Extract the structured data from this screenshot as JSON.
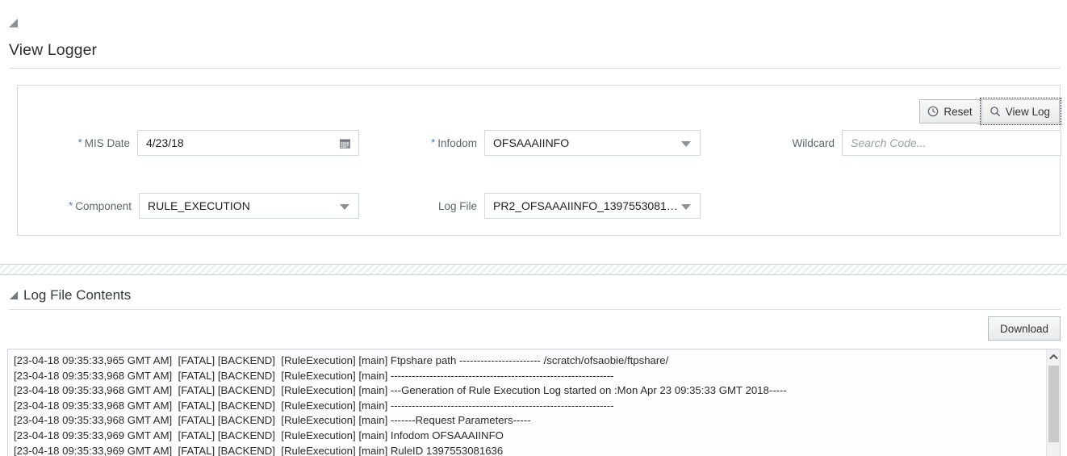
{
  "page": {
    "title": "View Logger",
    "collapse_icon": "triangle-collapse-icon"
  },
  "toolbar": {
    "reset_label": "Reset",
    "reset_icon": "clock-icon",
    "view_log_label": "View Log",
    "view_log_icon": "search-icon"
  },
  "form": {
    "mis_date": {
      "label": "MIS Date",
      "required": true,
      "value": "4/23/18",
      "icon": "calendar-icon"
    },
    "infodom": {
      "label": "Infodom",
      "required": true,
      "value": "OFSAAAIINFO",
      "icon": "chevron-down-icon"
    },
    "wildcard": {
      "label": "Wildcard",
      "required": false,
      "value": "",
      "placeholder": "Search Code..."
    },
    "component": {
      "label": "Component",
      "required": true,
      "value": "RULE_EXECUTION",
      "icon": "chevron-down-icon"
    },
    "log_file": {
      "label": "Log File",
      "required": false,
      "value": "PR2_OFSAAAIINFO_1397553081636...",
      "icon": "chevron-down-icon"
    }
  },
  "log_section": {
    "title": "Log File Contents",
    "collapse_icon": "triangle-collapse-icon",
    "download_label": "Download",
    "scroll_up_icon": "chevron-up-icon",
    "lines": [
      "[23-04-18 09:35:33,965 GMT AM]  [FATAL] [BACKEND]  [RuleExecution] [main] Ftpshare path ----------------------- /scratch/ofsaobie/ftpshare/",
      "[23-04-18 09:35:33,968 GMT AM]  [FATAL] [BACKEND]  [RuleExecution] [main] ---------------------------------------------------------------",
      "[23-04-18 09:35:33,968 GMT AM]  [FATAL] [BACKEND]  [RuleExecution] [main] ---Generation of Rule Execution Log started on :Mon Apr 23 09:35:33 GMT 2018-----",
      "[23-04-18 09:35:33,968 GMT AM]  [FATAL] [BACKEND]  [RuleExecution] [main] ---------------------------------------------------------------",
      "[23-04-18 09:35:33,968 GMT AM]  [FATAL] [BACKEND]  [RuleExecution] [main] -------Request Parameters-----",
      "[23-04-18 09:35:33,969 GMT AM]  [FATAL] [BACKEND]  [RuleExecution] [main] Infodom OFSAAAIINFO",
      "[23-04-18 09:35:33,969 GMT AM]  [FATAL] [BACKEND]  [RuleExecution] [main] RuleID 1397553081636"
    ]
  }
}
